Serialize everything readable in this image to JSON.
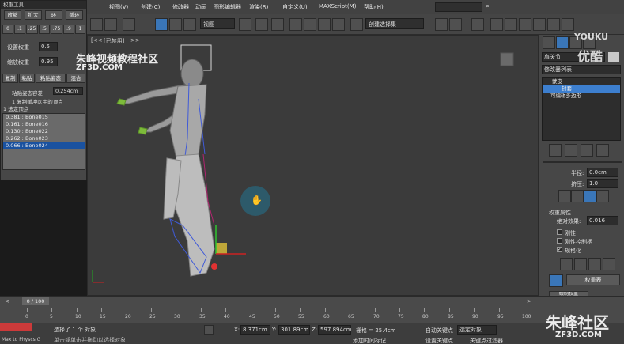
{
  "menubar": {
    "items": [
      "视图(V)",
      "创建(C)",
      "修改器",
      "动画",
      "图形编辑器",
      "渲染(R)",
      "自定义(U)",
      "MAXScript(M)",
      "帮助(H)"
    ]
  },
  "toolbar": {
    "view_select": "视图",
    "selection_set": "创建选择集"
  },
  "viewport": {
    "label_left": "]",
    "label_main": "[已禁用]",
    "label_prefix": "[<<",
    "label_suffix": ">>"
  },
  "weight_tool": {
    "title": "权重工具",
    "row1": [
      "收缩",
      "扩大",
      "环",
      "循环"
    ],
    "row2": [
      "0",
      ".1",
      ".25",
      ".5",
      ".75",
      ".9",
      "1"
    ],
    "set_weight_label": "设置权重",
    "set_weight_value": "0.5",
    "scale_weight_label": "缩放权重",
    "scale_weight_value": "0.95",
    "row_copy": [
      "复制",
      "粘贴",
      "粘贴姿态",
      "混合"
    ],
    "paste_tolerance_label": "粘贴姿态容差",
    "paste_tolerance_value": "0.254cm",
    "copy_buffer_info": "1 复制缓冲区中的顶点",
    "selected_info": "1 选定顶点",
    "bones": [
      {
        "weight": "0.381",
        "name": "Bone015"
      },
      {
        "weight": "0.161",
        "name": "Bone016"
      },
      {
        "weight": "0.130",
        "name": "Bone022"
      },
      {
        "weight": "0.262",
        "name": "Bone023"
      },
      {
        "weight": "0.066",
        "name": "Bone024"
      }
    ]
  },
  "cmd_panel": {
    "object_name": "肩关节",
    "modifier_list": "修改器列表",
    "stack": [
      "蒙皮",
      "封套",
      "可编辑多边形"
    ],
    "radius_label": "半径:",
    "radius_value": "0.0cm",
    "squash_label": "挤压:",
    "squash_value": "1.0",
    "weight_props": "权重属性",
    "abs_effect_label": "绝对效果:",
    "abs_effect_value": "0.016",
    "rigid": "刚性",
    "rigid_handles": "刚性控制柄",
    "normalize": "规格化",
    "weight_table": "权重表",
    "paint_weights": "绘制权重"
  },
  "timeline": {
    "frame_counter": "0 / 100",
    "ticks": [
      "0",
      "5",
      "10",
      "15",
      "20",
      "25",
      "30",
      "35",
      "40",
      "45",
      "50",
      "55",
      "60",
      "65",
      "70",
      "75",
      "80",
      "85",
      "90",
      "95",
      "100"
    ]
  },
  "status": {
    "selected": "选择了 1 个 对象",
    "hint": "单击或单击并拖动以选择对象",
    "max_to_physics": "Max to Physcs G",
    "x_label": "X:",
    "x_value": "8.371cm",
    "y_label": "Y:",
    "y_value": "301.89cm",
    "z_label": "Z:",
    "z_value": "597.894cm",
    "grid": "栅格 = 25.4cm",
    "add_time_tag": "添加时间标记",
    "auto_key": "自动关键点",
    "set_key": "设置关键点",
    "selected_obj": "选定对象",
    "key_filters": "关键点过滤器..."
  },
  "watermarks": {
    "top_logo": "朱峰视频教程社区",
    "top_url": "ZF3D.COM",
    "youku_en": "YOUKU",
    "youku_cn": "优酷",
    "bottom_logo": "朱峰社区",
    "bottom_url": "ZF3D.COM"
  },
  "colors": {
    "accent": "#3a76b8",
    "selected_row": "#1a52a0",
    "viewport_bg": "#3b3b3b"
  }
}
